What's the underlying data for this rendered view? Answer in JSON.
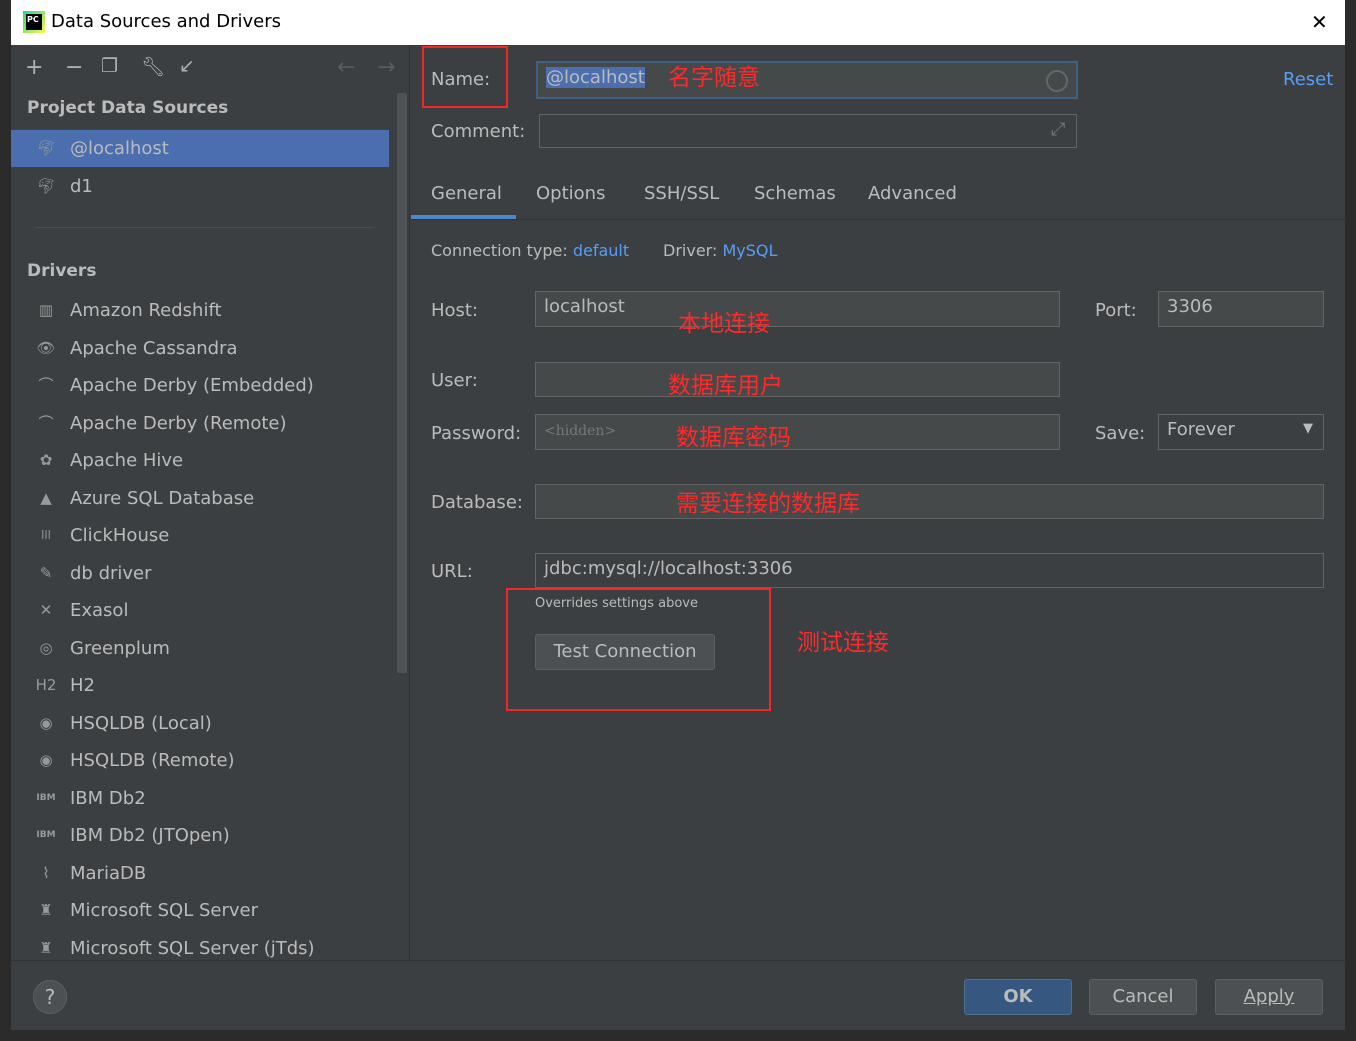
{
  "window": {
    "title": "Data Sources and Drivers",
    "close": "✕"
  },
  "sidebar": {
    "toolbar": [
      "add-icon",
      "remove-icon",
      "duplicate-icon",
      "wrench-icon",
      "import-icon",
      "back-icon",
      "forward-icon"
    ],
    "project_header": "Project Data Sources",
    "sources": [
      {
        "label": "@localhost",
        "selected": true
      },
      {
        "label": "d1"
      }
    ],
    "drivers_header": "Drivers",
    "drivers": [
      {
        "label": "Amazon Redshift",
        "icon": "▥"
      },
      {
        "label": "Apache Cassandra",
        "icon": "👁"
      },
      {
        "label": "Apache Derby (Embedded)",
        "icon": "⌒"
      },
      {
        "label": "Apache Derby (Remote)",
        "icon": "⌒"
      },
      {
        "label": "Apache Hive",
        "icon": "✿"
      },
      {
        "label": "Azure SQL Database",
        "icon": "▲"
      },
      {
        "label": "ClickHouse",
        "icon": "|||"
      },
      {
        "label": "db driver",
        "icon": "✎"
      },
      {
        "label": "Exasol",
        "icon": "✕"
      },
      {
        "label": "Greenplum",
        "icon": "◎"
      },
      {
        "label": "H2",
        "icon": "H2"
      },
      {
        "label": "HSQLDB (Local)",
        "icon": "◉"
      },
      {
        "label": "HSQLDB (Remote)",
        "icon": "◉"
      },
      {
        "label": "IBM Db2",
        "icon": "IBM"
      },
      {
        "label": "IBM Db2 (JTOpen)",
        "icon": "IBM"
      },
      {
        "label": "MariaDB",
        "icon": "⌇"
      },
      {
        "label": "Microsoft SQL Server",
        "icon": "♜"
      },
      {
        "label": "Microsoft SQL Server (jTds)",
        "icon": "♜"
      }
    ]
  },
  "form": {
    "name_label": "Name:",
    "name_value": "@localhost",
    "reset": "Reset",
    "comment_label": "Comment:",
    "comment_value": "",
    "tabs": [
      "General",
      "Options",
      "SSH/SSL",
      "Schemas",
      "Advanced"
    ],
    "active_tab": "General",
    "conn_type_label": "Connection type:",
    "conn_type": "default",
    "driver_label": "Driver:",
    "driver": "MySQL",
    "host_label": "Host:",
    "host": "localhost",
    "port_label": "Port:",
    "port": "3306",
    "user_label": "User:",
    "user": "",
    "password_label": "Password:",
    "password_placeholder": "<hidden>",
    "save_label": "Save:",
    "save_value": "Forever",
    "database_label": "Database:",
    "database": "",
    "url_label": "URL:",
    "url": "jdbc:mysql://localhost:3306",
    "url_hint": "Overrides settings above",
    "test_connection": "Test Connection"
  },
  "annotations": {
    "name": "名字随意",
    "host": "本地连接",
    "user": "数据库用户",
    "password": "数据库密码",
    "database": "需要连接的数据库",
    "test": "测试连接"
  },
  "footer": {
    "help": "?",
    "ok": "OK",
    "cancel": "Cancel",
    "apply": "Apply"
  },
  "colors": {
    "selection": "#4b6eaf",
    "link": "#589df6",
    "annotation": "#ff2a2a"
  }
}
